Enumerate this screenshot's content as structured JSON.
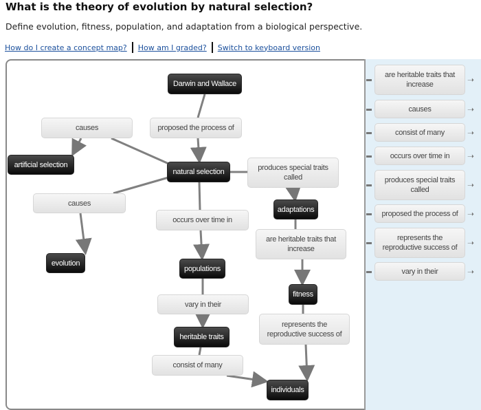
{
  "question": "What is the theory of evolution by natural selection?",
  "instructions": "Define evolution, fitness, population, and adaptation from a biological perspective.",
  "links": [
    "How do I create a concept map?",
    "How am I graded?",
    "Switch to keyboard version"
  ],
  "map": {
    "concepts": {
      "darwin": "Darwin and Wallace",
      "artificial": "artificial selection",
      "natural": "natural selection",
      "adaptations": "adaptations",
      "evolution": "evolution",
      "populations": "populations",
      "fitness": "fitness",
      "heritable": "heritable traits",
      "individuals": "individuals"
    },
    "links": {
      "causes1": "causes",
      "proposed": "proposed the process of",
      "produces": "produces special traits called",
      "causes2": "causes",
      "occurs": "occurs over time in",
      "areheritable": "are heritable traits that increase",
      "vary": "vary in their",
      "represents": "represents the reproductive success of",
      "consist": "consist of many"
    }
  },
  "bank": [
    "are heritable traits that increase",
    "causes",
    "consist of many",
    "occurs over time in",
    "produces special traits called",
    "proposed the process of",
    "represents the reproductive success of",
    "vary in their"
  ],
  "colors": {
    "concept": "#111111",
    "link": "#e8e8e8",
    "bank_bg": "#e3f0f8",
    "link_text": "#1a4f9c"
  }
}
